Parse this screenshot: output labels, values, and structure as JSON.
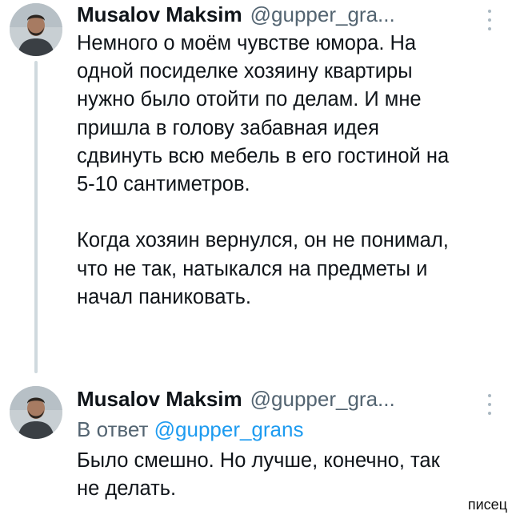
{
  "tweets": [
    {
      "author_name": "Musalov Maksim",
      "handle": "@gupper_gra...",
      "text": "Немного о моём чувстве юмора. На\nодной посиделке хозяину квартиры\nнужно было отойти по делам. И мне\nпришла в голову забавная идея\nсдвинуть всю мебель в его гостиной на\n5-10 сантиметров.\n\nКогда хозяин вернулся, он не понимал,\nчто не так, натыкался на предметы и\nначал паниковать."
    },
    {
      "author_name": "Musalov Maksim",
      "handle": "@gupper_gra...",
      "reply_prefix": "В ответ",
      "reply_handle": "@gupper_grans",
      "text": "Было смешно. Но лучше, конечно, так\nне делать."
    }
  ],
  "watermark": "писец",
  "icons": {
    "more": "more-vertical-icon",
    "avatar": "avatar-photo"
  },
  "colors": {
    "handle": "#536471",
    "link": "#1d9bf0",
    "thread_line": "#cfd9de"
  }
}
